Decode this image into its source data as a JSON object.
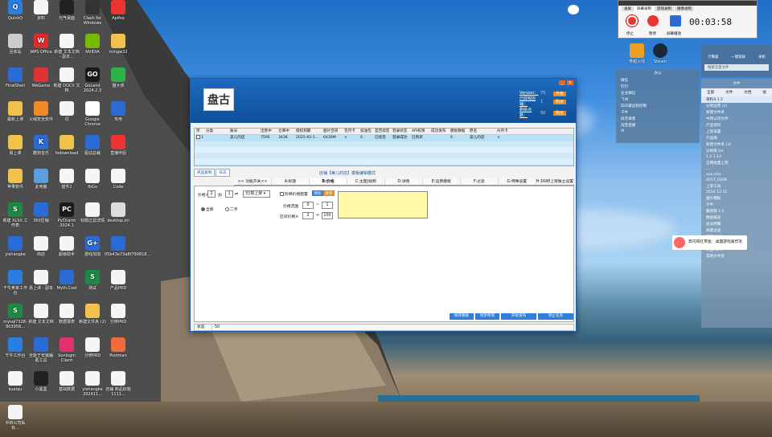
{
  "desktop_icons": [
    {
      "label": "QuickQ",
      "color": "#2a7de1",
      "glyph": "Q"
    },
    {
      "label": "资料",
      "color": "#f5f5f5",
      "glyph": ""
    },
    {
      "label": "元气桌面",
      "color": "#222",
      "glyph": ""
    },
    {
      "label": "Clash for Windows",
      "color": "#333",
      "glyph": ""
    },
    {
      "label": "Apifox",
      "color": "#e33",
      "glyph": ""
    },
    {
      "label": "回收站",
      "color": "#ccc",
      "glyph": ""
    },
    {
      "label": "WPS Office",
      "color": "#e02b2b",
      "glyph": "W"
    },
    {
      "label": "新建 文本文档 - 副本...",
      "color": "#f5f5f5",
      "glyph": ""
    },
    {
      "label": "NVIDIA",
      "color": "#76b900",
      "glyph": ""
    },
    {
      "label": "mingw32",
      "color": "#f0c24b",
      "glyph": ""
    },
    {
      "label": "FinalShell",
      "color": "#2a6bd6",
      "glyph": ""
    },
    {
      "label": "WeGame",
      "color": "#d33",
      "glyph": ""
    },
    {
      "label": "新建 DOCX 文档",
      "color": "#f5f5f5",
      "glyph": ""
    },
    {
      "label": "GoLand 2024.2.3",
      "color": "#1a1a1a",
      "glyph": "GO"
    },
    {
      "label": "猫大侠",
      "color": "#2db24a",
      "glyph": ""
    },
    {
      "label": "最新上课",
      "color": "#f0c24b",
      "glyph": ""
    },
    {
      "label": "火绒安全软件",
      "color": "#f08a24",
      "glyph": ""
    },
    {
      "label": "词",
      "color": "#f5f5f5",
      "glyph": ""
    },
    {
      "label": "Google Chrome",
      "color": "#fff",
      "glyph": ""
    },
    {
      "label": "专用",
      "color": "#2a6bd6",
      "glyph": ""
    },
    {
      "label": "易上课",
      "color": "#f0c24b",
      "glyph": ""
    },
    {
      "label": "酷狗音乐",
      "color": "#2a6bd6",
      "glyph": "K"
    },
    {
      "label": "fsdownload",
      "color": "#f0c24b",
      "glyph": ""
    },
    {
      "label": "驱动总裁",
      "color": "#2a6bd6",
      "glyph": ""
    },
    {
      "label": "直播伴侣",
      "color": "#e33",
      "glyph": ""
    },
    {
      "label": "苹果软件",
      "color": "#f0c24b",
      "glyph": ""
    },
    {
      "label": "此电脑",
      "color": "#5aa0e0",
      "glyph": ""
    },
    {
      "label": "插件2",
      "color": "#f5f5f5",
      "glyph": ""
    },
    {
      "label": "fbGo",
      "color": "#f5f5f5",
      "glyph": ""
    },
    {
      "label": "Code",
      "color": "#f5f5f5",
      "glyph": ""
    },
    {
      "label": "新建 XLSX 工作表",
      "color": "#1d8a43",
      "glyph": "S"
    },
    {
      "label": "360压缩",
      "color": "#2a6bd6",
      "glyph": ""
    },
    {
      "label": "PyCharm 2024.1",
      "color": "#1a1a1a",
      "glyph": "PC"
    },
    {
      "label": "标题过滤详情",
      "color": "#f5f5f5",
      "glyph": ""
    },
    {
      "label": "desktop.ini",
      "color": "#ddd",
      "glyph": ""
    },
    {
      "label": "yishangke",
      "color": "#2a6bd6",
      "glyph": ""
    },
    {
      "label": "商店",
      "color": "#f5f5f5",
      "glyph": ""
    },
    {
      "label": "超级助手",
      "color": "#f5f5f5",
      "glyph": ""
    },
    {
      "label": "游戏加加",
      "color": "#2a6bd6",
      "glyph": "G+"
    },
    {
      "label": "05b43e73a8f790818...",
      "color": "#2a6bd6",
      "glyph": ""
    },
    {
      "label": "千牛卖家工作台",
      "color": "#2a7de1",
      "glyph": ""
    },
    {
      "label": "易上课 - 副本",
      "color": "#f5f5f5",
      "glyph": ""
    },
    {
      "label": "Myth.Cool",
      "color": "#2a6bd6",
      "glyph": ""
    },
    {
      "label": "测试",
      "color": "#1d8a43",
      "glyph": "S"
    },
    {
      "label": "产品PRD",
      "color": "#f5f5f5",
      "glyph": ""
    },
    {
      "label": "mysql7328-803958...",
      "color": "#1d8a43",
      "glyph": "S"
    },
    {
      "label": "新建 文本文档",
      "color": "#f5f5f5",
      "glyph": ""
    },
    {
      "label": "数据报表",
      "color": "#f5f5f5",
      "glyph": ""
    },
    {
      "label": "新建文件夹 (2)",
      "color": "#f0c24b",
      "glyph": ""
    },
    {
      "label": "分辨PRD",
      "color": "#f5f5f5",
      "glyph": ""
    },
    {
      "label": "千牛工作台",
      "color": "#2a7de1",
      "glyph": ""
    },
    {
      "label": "全能王安装辅助工具",
      "color": "#2a6bd6",
      "glyph": ""
    },
    {
      "label": "Sunlogin Client",
      "color": "#e0336b",
      "glyph": ""
    },
    {
      "label": "分辨PRD",
      "color": "#f5f5f5",
      "glyph": ""
    },
    {
      "label": "Postman",
      "color": "#f26b3a",
      "glyph": ""
    },
    {
      "label": "kuaiqu",
      "color": "#f5f5f5",
      "glyph": ""
    },
    {
      "label": "小黑盒",
      "color": "#222",
      "glyph": ""
    },
    {
      "label": "基础数据",
      "color": "#f5f5f5",
      "glyph": ""
    },
    {
      "label": "yishangke 202411...",
      "color": "#f5f5f5",
      "glyph": ""
    },
    {
      "label": "店铺 商品标题1111...",
      "color": "#f5f5f5",
      "glyph": ""
    },
    {
      "label": "中转公司私有...",
      "color": "#f5f5f5",
      "glyph": ""
    }
  ],
  "window": {
    "logo_text": "盘古",
    "controls": [
      "_",
      "x"
    ],
    "info": [
      {
        "key": "Version：",
        "value": "75",
        "button": "升级"
      },
      {
        "key": "已授权店铺：",
        "value": "1",
        "button": "购买"
      },
      {
        "key": "剩余点数：",
        "value": "50",
        "button": "购买"
      }
    ],
    "table": {
      "headers": [
        "序",
        "分类",
        "账号",
        "出售中",
        "仓库中",
        "授权到期",
        "图片空间",
        "包月卡",
        "加油包",
        "是否续签",
        "登录状态",
        "API权限",
        "成功发布",
        "模板数据",
        "原名",
        "AI月卡"
      ],
      "row": [
        "1",
        "",
        "美儿的店",
        "7595",
        "3436",
        "2025-02-1...",
        "6439M",
        "×",
        "0",
        "已续签",
        "登录成功",
        "已购买",
        "",
        "0",
        "美儿的店",
        "×"
      ]
    },
    "tabs_top": [
      "商品复制",
      "日志"
    ],
    "notice": "店铺【美儿的店】模板编辑模式",
    "tabs": [
      ">> 功能开关<<",
      "A:标题",
      "B:价格",
      "C:主图|视频",
      "D:详情",
      "E:运费模版",
      "F:过滤",
      "G:特殊设置",
      "H:1688上架独立设置"
    ],
    "active_tab": "B:价格",
    "price": {
      "label": "价格×",
      "mult": "2",
      "plus_label": "加",
      "plus": "1",
      "mode": "元(取上架",
      "radio_all": "全新",
      "radio_used": "二手",
      "sku_label": "阶梯价格配置",
      "btn1": "添加",
      "btn2": "清空",
      "range_label": "价格范围",
      "range_from": "0",
      "range_to": "1",
      "ladder_label": "区间价格×",
      "ladder_mult": "2",
      "ladder_plus": "100"
    },
    "buttons": [
      "保存模板",
      "同步所有",
      "开始发布",
      "停止任务"
    ],
    "status": {
      "label": "状态",
      "value": "50"
    }
  },
  "recorder": {
    "tabs": [
      "录屏",
      "屏幕录制",
      "游戏录制",
      "摄像录制"
    ],
    "time": "00:03:58",
    "labels": [
      "停止",
      "暂停",
      "屏幕播放"
    ]
  },
  "qq_panel": {
    "title": "文件",
    "tabs": [
      "全部",
      "文件",
      "文档",
      "收"
    ],
    "items": [
      "资料4.1.1",
      "分销运营 (2)",
      "新建文件夹",
      "中转公司文件",
      "产品资料",
      "上架设置",
      "产品库",
      "新建文件夹 (3)",
      "分辨率.txt",
      "1.2.1.13",
      "全网批量上架",
      "...",
      "xxx.xlsx",
      "4017_0209",
      "上架工具",
      "2024 12 11",
      "图片模板",
      "千牛",
      "最新版 1.5",
      "数据报表",
      "会员明细",
      "标题过滤",
      "新建 文档",
      "淘宝 2024",
      "商品 12 1",
      "其他文件夹"
    ]
  },
  "group_panel": {
    "title": "办公",
    "items": [
      "微信",
      "钉钉",
      "企业微信",
      "飞书",
      "向日葵远程控制",
      "千牛",
      "抖音来客",
      "淘宝直播",
      "AI"
    ]
  },
  "top_tools": [
    "工具",
    "计算器",
    "一键锁屏",
    "关机",
    "搜索全盘文件"
  ],
  "tray_apps": [
    "穿越火线",
    "Steam"
  ],
  "notification": "奔闪同红带鱼：桌面游戏爱炸毛"
}
